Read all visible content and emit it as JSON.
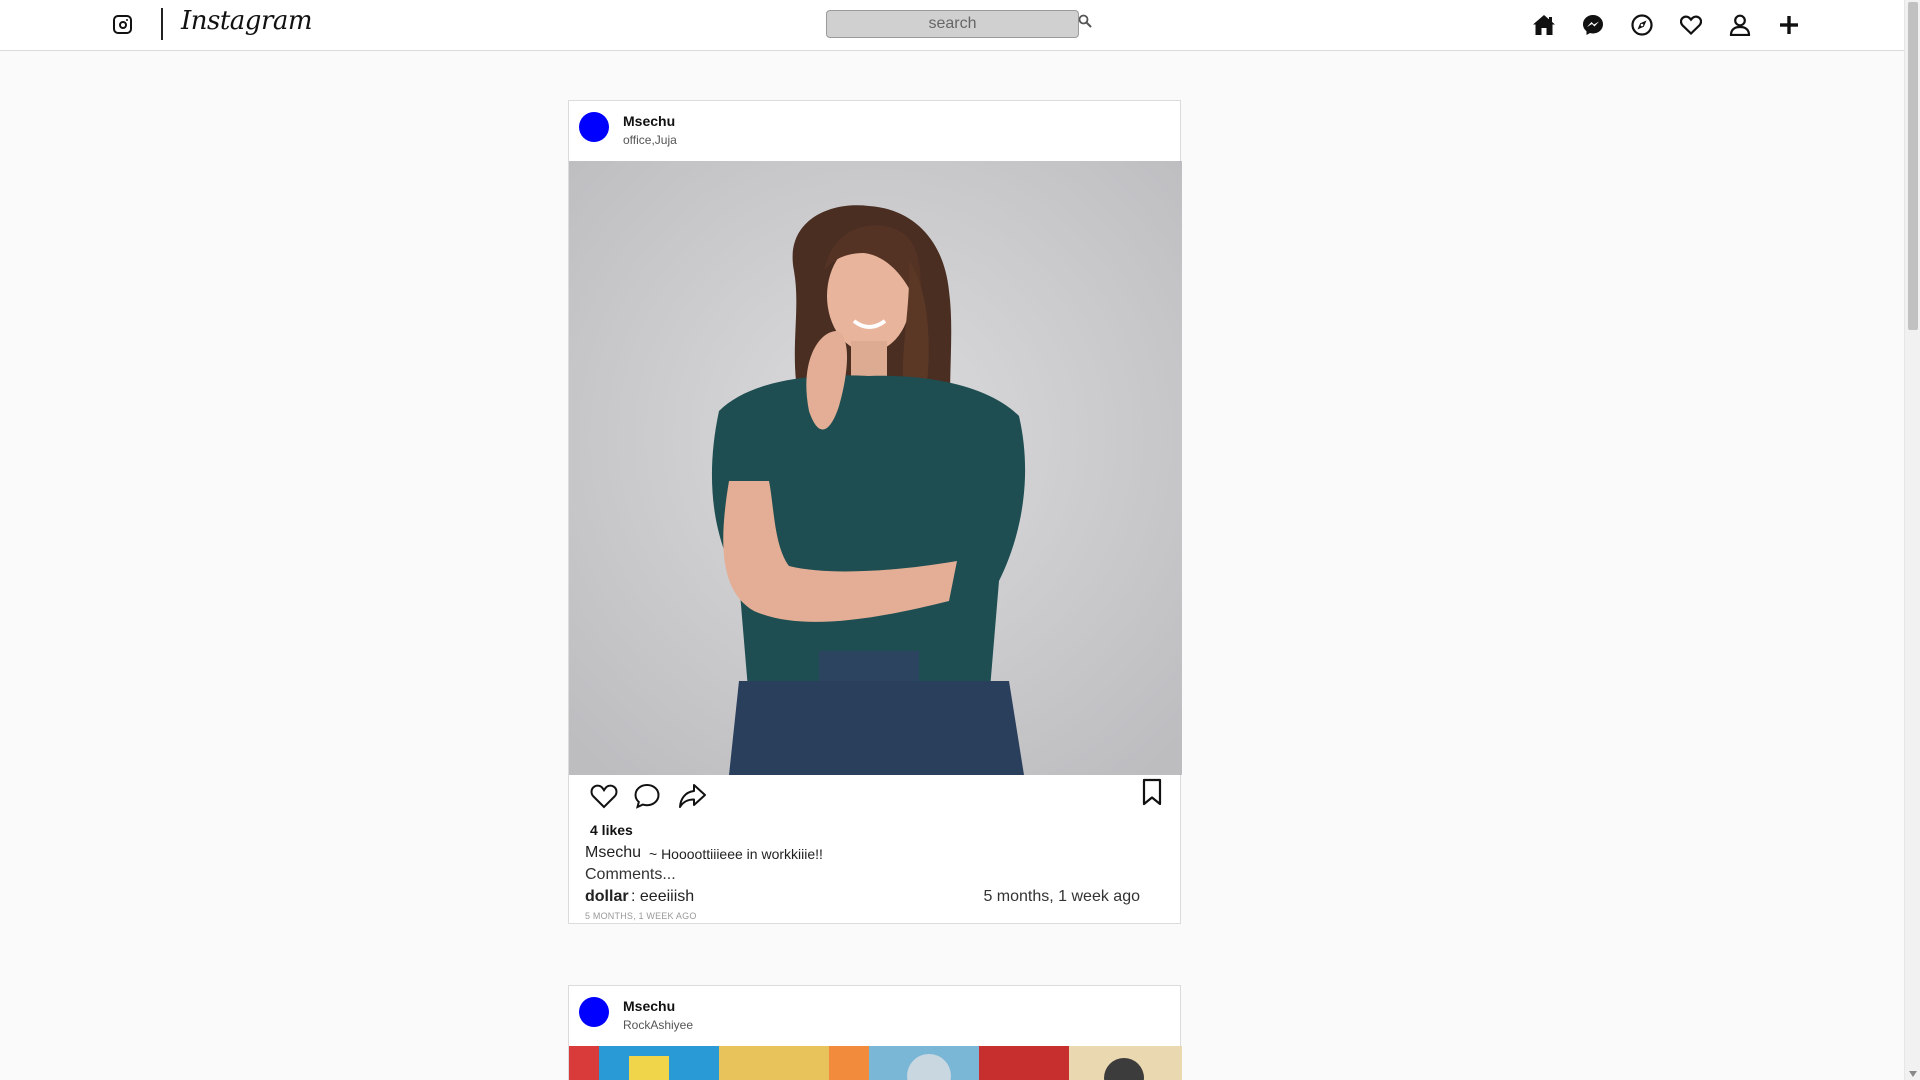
{
  "app": {
    "wordmark": "Instagram"
  },
  "search": {
    "placeholder": "search"
  },
  "nav": {
    "icons": [
      "home-icon",
      "messenger-icon",
      "explore-icon",
      "heart-icon",
      "profile-icon",
      "add-icon"
    ]
  },
  "posts": [
    {
      "username": "Msechu",
      "location": "office,Juja",
      "avatar_color": "#0000ff",
      "likes": "4 likes",
      "caption_user": "Msechu",
      "caption": "~ Hoooottiiieee in workkiiie!!",
      "comments_label": "Comments...",
      "comment_user": "dollar",
      "comment_text": ": eeeiiish",
      "comment_age": "5 months, 1 week ago",
      "post_age": "5 MONTHS, 1 WEEK AGO"
    },
    {
      "username": "Msechu",
      "location": "RockAshiyee",
      "avatar_color": "#0000ff"
    }
  ]
}
